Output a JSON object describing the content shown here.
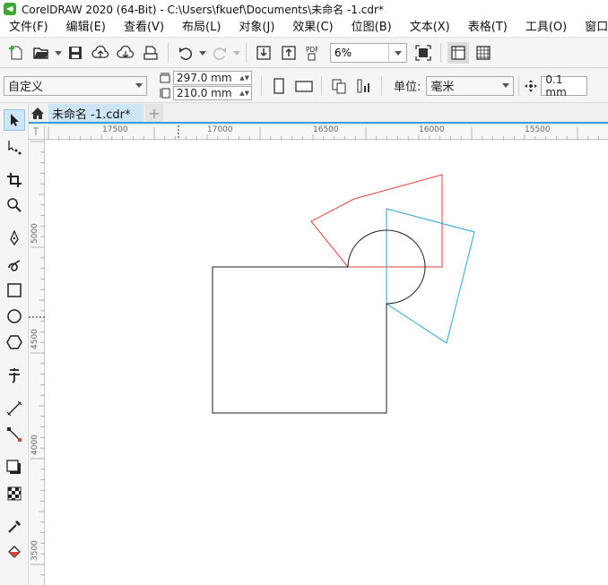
{
  "window": {
    "title": "CorelDRAW 2020 (64-Bit) - C:\\Users\\fkuef\\Documents\\未命名 -1.cdr*"
  },
  "menu": [
    "文件(F)",
    "编辑(E)",
    "查看(V)",
    "布局(L)",
    "对象(J)",
    "效果(C)",
    "位图(B)",
    "文本(X)",
    "表格(T)",
    "工具(O)",
    "窗口"
  ],
  "toolbar": {
    "zoom_value": "6%",
    "pdf_label": "PDF"
  },
  "propbar": {
    "page_size": "自定义",
    "width": "297.0 mm",
    "height": "210.0 mm",
    "units_label": "单位:",
    "units_value": "毫米",
    "nudge": "0.1 mm"
  },
  "tabs": {
    "document": "未命名 -1.cdr*",
    "add": "+"
  },
  "rulers": {
    "horizontal": [
      "17500",
      "17000",
      "16500",
      "16000",
      "15500"
    ],
    "vertical": [
      "5000",
      "4500",
      "4000",
      "3500"
    ]
  },
  "toolbox_icons": [
    "pick-tool-icon",
    "shape-tool-icon",
    "crop-tool-icon",
    "zoom-tool-icon",
    "freehand-tool-icon",
    "artistic-media-icon",
    "rectangle-tool-icon",
    "ellipse-tool-icon",
    "polygon-tool-icon",
    "text-tool-icon",
    "parallel-dimension-icon",
    "connector-tool-icon",
    "drop-shadow-icon",
    "transparency-tool-icon",
    "eyedropper-tool-icon",
    "interactive-fill-icon"
  ],
  "colors": {
    "accent": "#3a9bdc",
    "shape_red": "#d9443a",
    "shape_blue": "#2aa6d8",
    "shape_black": "#222222"
  }
}
